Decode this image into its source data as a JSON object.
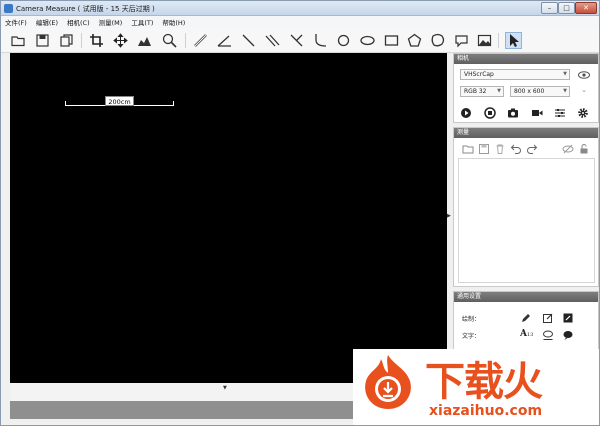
{
  "window": {
    "title": "Camera Measure  ( 试用版 - 15 天后过期 )",
    "controls": {
      "minimize": "–",
      "maximize": "□",
      "close": "✕"
    }
  },
  "menu": [
    "文件(F)",
    "编辑(E)",
    "相机(C)",
    "测量(M)",
    "工具(T)",
    "帮助(H)"
  ],
  "toolbar": {
    "tools": [
      "open-icon",
      "save-icon",
      "copy-icon",
      "crop-icon",
      "move-icon",
      "histogram-icon",
      "zoom-icon",
      "ruler-icon",
      "angle-icon",
      "line-icon",
      "parallel-icon",
      "cross-line-icon",
      "curve-icon",
      "circle-icon",
      "ellipse-icon",
      "rectangle-icon",
      "polygon-icon",
      "freeform-icon",
      "comment-icon",
      "image-icon",
      "pointer-icon"
    ],
    "active_tool": "pointer-icon"
  },
  "canvas": {
    "scale_label": "200cm",
    "background": "#000000"
  },
  "camera_panel": {
    "title": "相机",
    "device": "VHScrCap",
    "format": "RGB 32",
    "resolution": "800 x 600"
  },
  "measure_panel": {
    "title": "测量"
  },
  "settings_panel": {
    "title": "通用设置",
    "draw_label": "绘制：",
    "text_label": "文字：",
    "font_size": "13"
  },
  "watermark": {
    "brand": "下载火",
    "url": "xiazaihuo.com"
  },
  "colors": {
    "accent": "#e8501e",
    "panel_header": "#6e6e6e",
    "status_bar": "#8f8f8f"
  }
}
